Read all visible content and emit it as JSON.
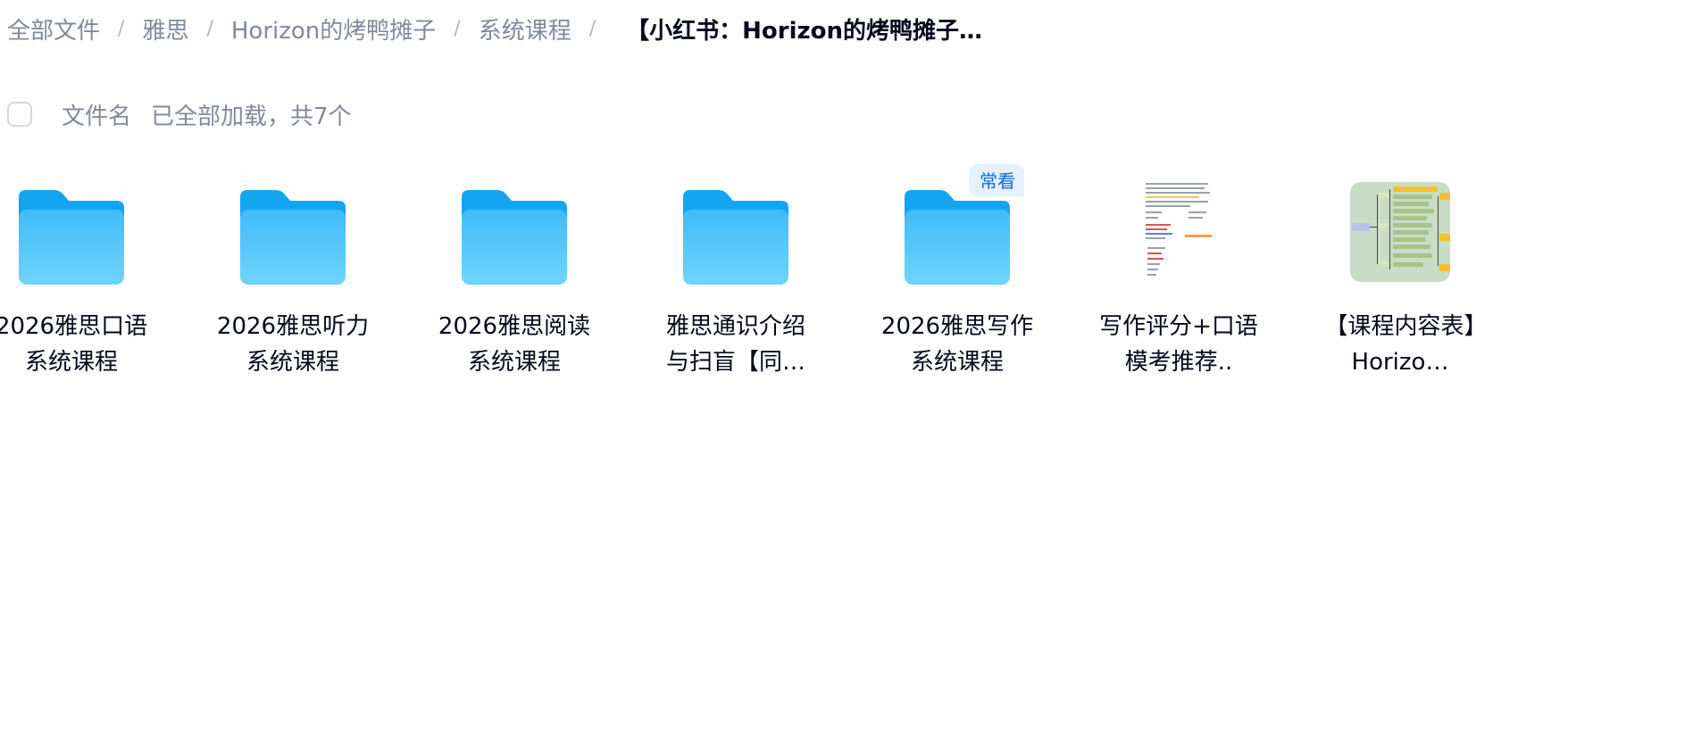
{
  "breadcrumb": {
    "items": [
      "全部文件",
      "雅思",
      "Horizon的烤鸭摊子",
      "系统课程"
    ],
    "separator": "/",
    "current": "【小红书：Horizon的烤鸭摊子…"
  },
  "list_header": {
    "name_label": "文件名",
    "status": "已全部加载，共7个"
  },
  "files": [
    {
      "name": "2026雅思口语系统课程",
      "type": "folder"
    },
    {
      "name": "2026雅思听力系统课程",
      "type": "folder"
    },
    {
      "name": "2026雅思阅读系统课程",
      "type": "folder"
    },
    {
      "name": "雅思通识介绍与扫盲【同…",
      "type": "folder"
    },
    {
      "name": "2026雅思写作系统课程",
      "type": "folder",
      "badge": "常看"
    },
    {
      "name": "写作评分+口语模考推荐..",
      "type": "document"
    },
    {
      "name": "【课程内容表】Horizo…",
      "type": "mindmap"
    }
  ],
  "colors": {
    "folder_top": "#14a5f0",
    "folder_body": "#5cc8fb",
    "badge_bg": "#e5f1ff",
    "badge_text": "#0d6bde",
    "muted_text": "#818999"
  }
}
